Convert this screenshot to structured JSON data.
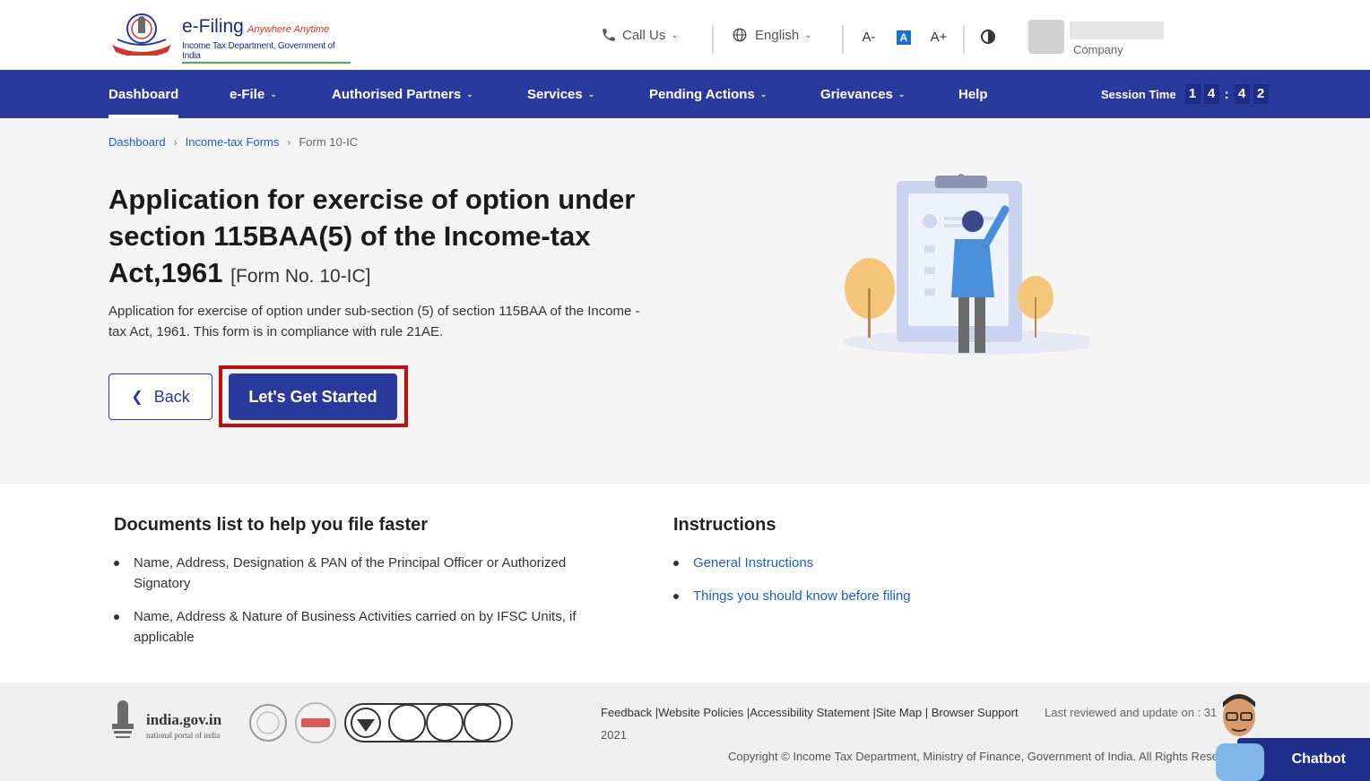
{
  "header": {
    "logo_title": "e-Filing",
    "logo_tagline": "Anywhere Anytime",
    "logo_subtitle": "Income Tax Department, Government of India",
    "call_us": "Call Us",
    "language": "English",
    "font_decrease": "A-",
    "font_normal": "A",
    "font_increase": "A+",
    "user_role": "Company"
  },
  "nav": {
    "items": [
      {
        "label": "Dashboard",
        "dropdown": false,
        "active": true
      },
      {
        "label": "e-File",
        "dropdown": true
      },
      {
        "label": "Authorised Partners",
        "dropdown": true
      },
      {
        "label": "Services",
        "dropdown": true
      },
      {
        "label": "Pending Actions",
        "dropdown": true
      },
      {
        "label": "Grievances",
        "dropdown": true
      },
      {
        "label": "Help",
        "dropdown": false
      }
    ],
    "session_label": "Session Time",
    "session_digits": [
      "1",
      "4",
      "4",
      "2"
    ]
  },
  "breadcrumb": [
    "Dashboard",
    "Income-tax Forms",
    "Form 10-IC"
  ],
  "page": {
    "title": "Application for exercise of option under section 115BAA(5) of the Income-tax Act,1961",
    "form_no": "[Form No. 10-IC]",
    "description": "Application for exercise of option under sub-section (5) of section 115BAA of the Income - tax Act, 1961. This form is in compliance with rule 21AE.",
    "back_label": "Back",
    "start_label": "Let's Get Started"
  },
  "documents": {
    "heading": "Documents list to help you file faster",
    "items": [
      "Name, Address, Designation & PAN of the Principal Officer or Authorized Signatory",
      "Name, Address & Nature of Business Activities carried on by IFSC Units, if applicable"
    ]
  },
  "instructions": {
    "heading": "Instructions",
    "links": [
      "General Instructions",
      "Things you should know before filing"
    ]
  },
  "footer": {
    "gov_title": "india.gov.in",
    "gov_subtitle": "national portal of india",
    "links": "Feedback |Website Policies |Accessibility Statement |Site Map | Browser Support",
    "last_reviewed": "Last reviewed and update on : 31",
    "year": "2021",
    "copyright": "Copyright © Income Tax Department, Ministry of Finance, Government of India. All Rights Reserved"
  },
  "chatbot_label": "Chatbot",
  "colors": {
    "nav_bg": "#2a3a9c",
    "primary": "#2a3a9c",
    "link": "#1c5fc7",
    "highlight": "#c00d0d",
    "hero_bg": "#f5f5f5"
  }
}
